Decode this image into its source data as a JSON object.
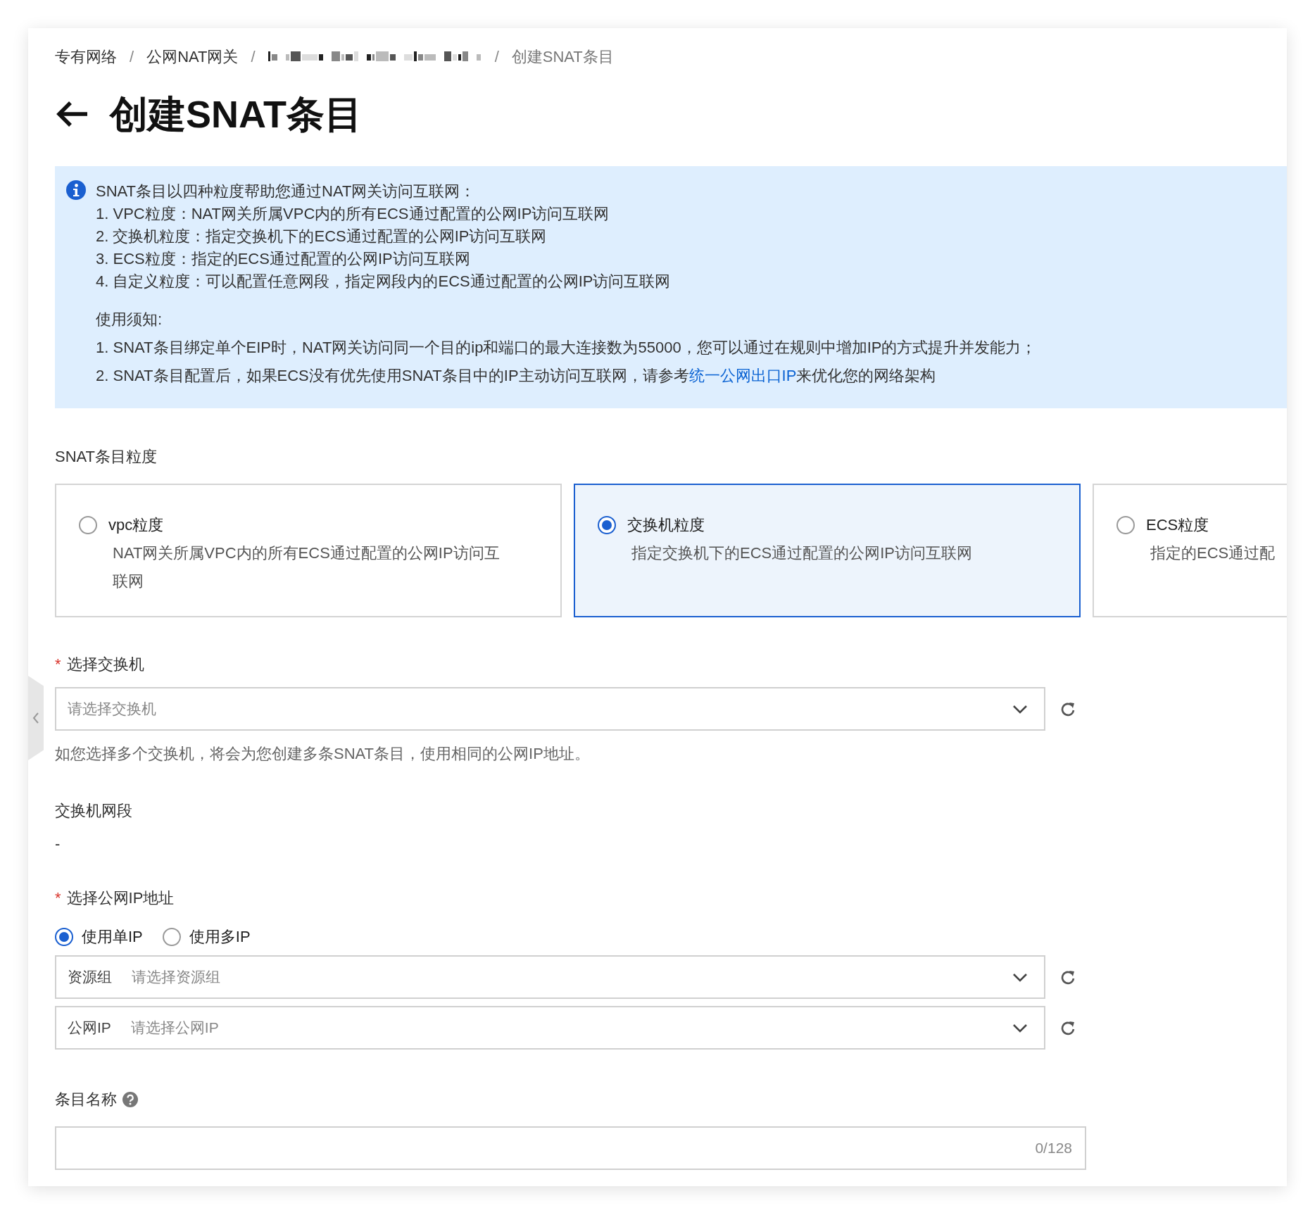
{
  "breadcrumb_separator": "/",
  "breadcrumb": [
    {
      "kind": "link",
      "label": "专有网络"
    },
    {
      "kind": "link",
      "label": "公网NAT网关"
    },
    {
      "kind": "redacted"
    },
    {
      "kind": "current",
      "label": "创建SNAT条目"
    }
  ],
  "page_title": "创建SNAT条目",
  "notice": {
    "intro": "SNAT条目以四种粒度帮助您通过NAT网关访问互联网：",
    "items": [
      "1. VPC粒度：NAT网关所属VPC内的所有ECS通过配置的公网IP访问互联网",
      "2. 交换机粒度：指定交换机下的ECS通过配置的公网IP访问互联网",
      "3. ECS粒度：指定的ECS通过配置的公网IP访问互联网",
      "4. 自定义粒度：可以配置任意网段，指定网段内的ECS通过配置的公网IP访问互联网"
    ],
    "usage_title": "使用须知:",
    "usage_items": [
      {
        "text": "1. SNAT条目绑定单个EIP时，NAT网关访问同一个目的ip和端口的最大连接数为55000，您可以通过在规则中增加IP的方式提升并发能力；"
      },
      {
        "text": "2. SNAT条目配置后，如果ECS没有优先使用SNAT条目中的IP主动访问互联网，请参考",
        "link": "统一公网出口IP",
        "after": "来优化您的网络架构"
      }
    ]
  },
  "granularity": {
    "label": "SNAT条目粒度",
    "options": [
      {
        "title": "vpc粒度",
        "description": "NAT网关所属VPC内的所有ECS通过配置的公网IP访问互联网",
        "selected": false
      },
      {
        "title": "交换机粒度",
        "description": "指定交换机下的ECS通过配置的公网IP访问互联网",
        "selected": true
      },
      {
        "title": "ECS粒度",
        "description": "指定的ECS通过配",
        "selected": false
      }
    ]
  },
  "switch_field": {
    "required_mark": "*",
    "label": "选择交换机",
    "placeholder": "请选择交换机",
    "help": "如您选择多个交换机，将会为您创建多条SNAT条目，使用相同的公网IP地址。"
  },
  "switch_cidr": {
    "label": "交换机网段",
    "value": "-"
  },
  "public_ip": {
    "required_mark": "*",
    "label": "选择公网IP地址",
    "modes": [
      {
        "label": "使用单IP",
        "selected": true
      },
      {
        "label": "使用多IP",
        "selected": false
      }
    ],
    "selects": [
      {
        "prefix": "资源组",
        "placeholder": "请选择资源组"
      },
      {
        "prefix": "公网IP",
        "placeholder": "请选择公网IP"
      }
    ]
  },
  "entry_name": {
    "label": "条目名称",
    "counter": "0/128"
  }
}
